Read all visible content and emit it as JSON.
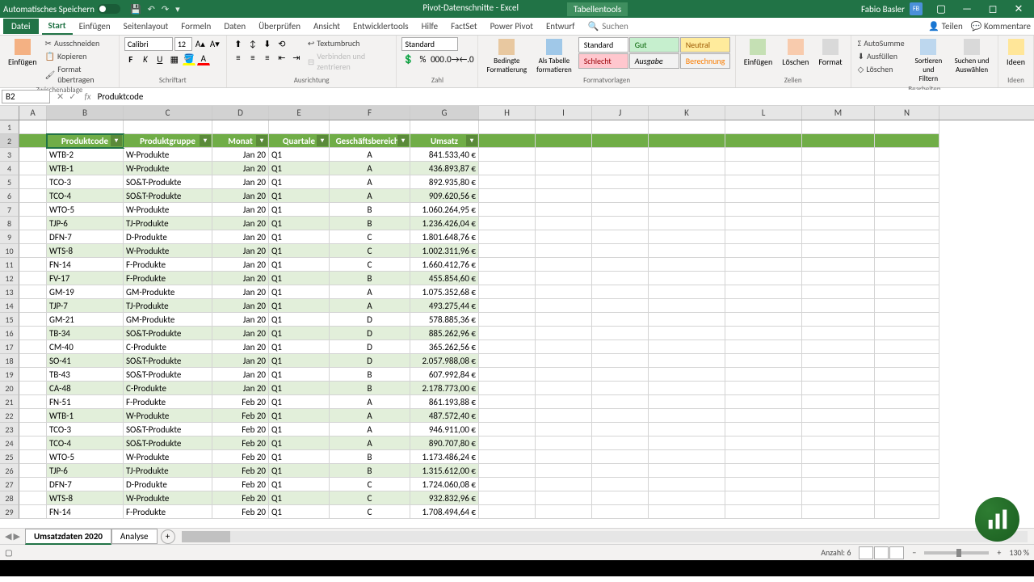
{
  "titlebar": {
    "autosave": "Automatisches Speichern",
    "filename": "Pivot-Datenschnitte - Excel",
    "tooltab": "Tabellentools",
    "user": "Fabio Basler",
    "user_initials": "FB"
  },
  "tabs": {
    "file": "Datei",
    "items": [
      "Start",
      "Einfügen",
      "Seitenlayout",
      "Formeln",
      "Daten",
      "Überprüfen",
      "Ansicht",
      "Entwicklertools",
      "Hilfe",
      "FactSet",
      "Power Pivot",
      "Entwurf"
    ],
    "search": "Suchen",
    "share": "Teilen",
    "comments": "Kommentare"
  },
  "ribbon": {
    "clipboard": {
      "label": "Zwischenablage",
      "paste": "Einfügen",
      "cut": "Ausschneiden",
      "copy": "Kopieren",
      "format": "Format übertragen"
    },
    "font": {
      "label": "Schriftart",
      "name": "Calibri",
      "size": "12"
    },
    "align": {
      "label": "Ausrichtung",
      "wrap": "Textumbruch",
      "merge": "Verbinden und zentrieren"
    },
    "number": {
      "label": "Zahl",
      "format": "Standard"
    },
    "styles": {
      "label": "Formatvorlagen",
      "cond": "Bedingte Formatierung",
      "table": "Als Tabelle formatieren",
      "standard": "Standard",
      "gut": "Gut",
      "neutral": "Neutral",
      "schlecht": "Schlecht",
      "ausgabe": "Ausgabe",
      "berechnung": "Berechnung"
    },
    "cells": {
      "label": "Zellen",
      "insert": "Einfügen",
      "delete": "Löschen",
      "format": "Format"
    },
    "editing": {
      "label": "Bearbeiten",
      "sum": "AutoSumme",
      "fill": "Ausfüllen",
      "clear": "Löschen",
      "sort": "Sortieren und Filtern",
      "find": "Suchen und Auswählen"
    },
    "ideas": {
      "label": "Ideen",
      "btn": "Ideen"
    }
  },
  "namebox": "B2",
  "formula": "Produktcode",
  "columns": [
    "A",
    "B",
    "C",
    "D",
    "E",
    "F",
    "G",
    "H",
    "I",
    "J",
    "K",
    "L",
    "M",
    "N"
  ],
  "table": {
    "headers": [
      "Produktcode",
      "Produktgruppe",
      "Monat",
      "Quartale",
      "Geschäftsbereiche",
      "Umsatz"
    ],
    "rows": [
      [
        "WTB-2",
        "W-Produkte",
        "Jan 20",
        "Q1",
        "A",
        "841.533,40 €"
      ],
      [
        "WTB-1",
        "W-Produkte",
        "Jan 20",
        "Q1",
        "A",
        "436.893,87 €"
      ],
      [
        "TCO-3",
        "SO&T-Produkte",
        "Jan 20",
        "Q1",
        "A",
        "892.935,80 €"
      ],
      [
        "TCO-4",
        "SO&T-Produkte",
        "Jan 20",
        "Q1",
        "A",
        "909.620,56 €"
      ],
      [
        "WTO-5",
        "W-Produkte",
        "Jan 20",
        "Q1",
        "B",
        "1.060.264,95 €"
      ],
      [
        "TJP-6",
        "TJ-Produkte",
        "Jan 20",
        "Q1",
        "B",
        "1.236.426,04 €"
      ],
      [
        "DFN-7",
        "D-Produkte",
        "Jan 20",
        "Q1",
        "C",
        "1.801.648,76 €"
      ],
      [
        "WTS-8",
        "W-Produkte",
        "Jan 20",
        "Q1",
        "C",
        "1.002.311,96 €"
      ],
      [
        "FN-14",
        "F-Produkte",
        "Jan 20",
        "Q1",
        "C",
        "1.660.412,76 €"
      ],
      [
        "FV-17",
        "F-Produkte",
        "Jan 20",
        "Q1",
        "B",
        "455.854,60 €"
      ],
      [
        "GM-19",
        "GM-Produkte",
        "Jan 20",
        "Q1",
        "A",
        "1.075.352,68 €"
      ],
      [
        "TJP-7",
        "TJ-Produkte",
        "Jan 20",
        "Q1",
        "A",
        "493.275,44 €"
      ],
      [
        "GM-21",
        "GM-Produkte",
        "Jan 20",
        "Q1",
        "D",
        "578.885,36 €"
      ],
      [
        "TB-34",
        "SO&T-Produkte",
        "Jan 20",
        "Q1",
        "D",
        "885.262,96 €"
      ],
      [
        "CM-40",
        "C-Produkte",
        "Jan 20",
        "Q1",
        "D",
        "365.262,56 €"
      ],
      [
        "SO-41",
        "SO&T-Produkte",
        "Jan 20",
        "Q1",
        "D",
        "2.057.988,08 €"
      ],
      [
        "TB-43",
        "SO&T-Produkte",
        "Jan 20",
        "Q1",
        "B",
        "607.992,84 €"
      ],
      [
        "CA-48",
        "C-Produkte",
        "Jan 20",
        "Q1",
        "B",
        "2.178.773,00 €"
      ],
      [
        "FN-51",
        "F-Produkte",
        "Feb 20",
        "Q1",
        "A",
        "861.193,88 €"
      ],
      [
        "WTB-1",
        "W-Produkte",
        "Feb 20",
        "Q1",
        "A",
        "487.572,40 €"
      ],
      [
        "TCO-3",
        "SO&T-Produkte",
        "Feb 20",
        "Q1",
        "A",
        "946.911,00 €"
      ],
      [
        "TCO-4",
        "SO&T-Produkte",
        "Feb 20",
        "Q1",
        "A",
        "890.707,80 €"
      ],
      [
        "WTO-5",
        "W-Produkte",
        "Feb 20",
        "Q1",
        "B",
        "1.173.486,24 €"
      ],
      [
        "TJP-6",
        "TJ-Produkte",
        "Feb 20",
        "Q1",
        "B",
        "1.315.612,00 €"
      ],
      [
        "DFN-7",
        "D-Produkte",
        "Feb 20",
        "Q1",
        "C",
        "1.724.060,08 €"
      ],
      [
        "WTS-8",
        "W-Produkte",
        "Feb 20",
        "Q1",
        "C",
        "932.832,96 €"
      ],
      [
        "FN-14",
        "F-Produkte",
        "Feb 20",
        "Q1",
        "C",
        "1.708.494,64 €"
      ]
    ]
  },
  "sheets": {
    "active": "Umsatzdaten 2020",
    "other": "Analyse"
  },
  "status": {
    "count_label": "Anzahl:",
    "count": "6",
    "zoom": "130 %"
  }
}
